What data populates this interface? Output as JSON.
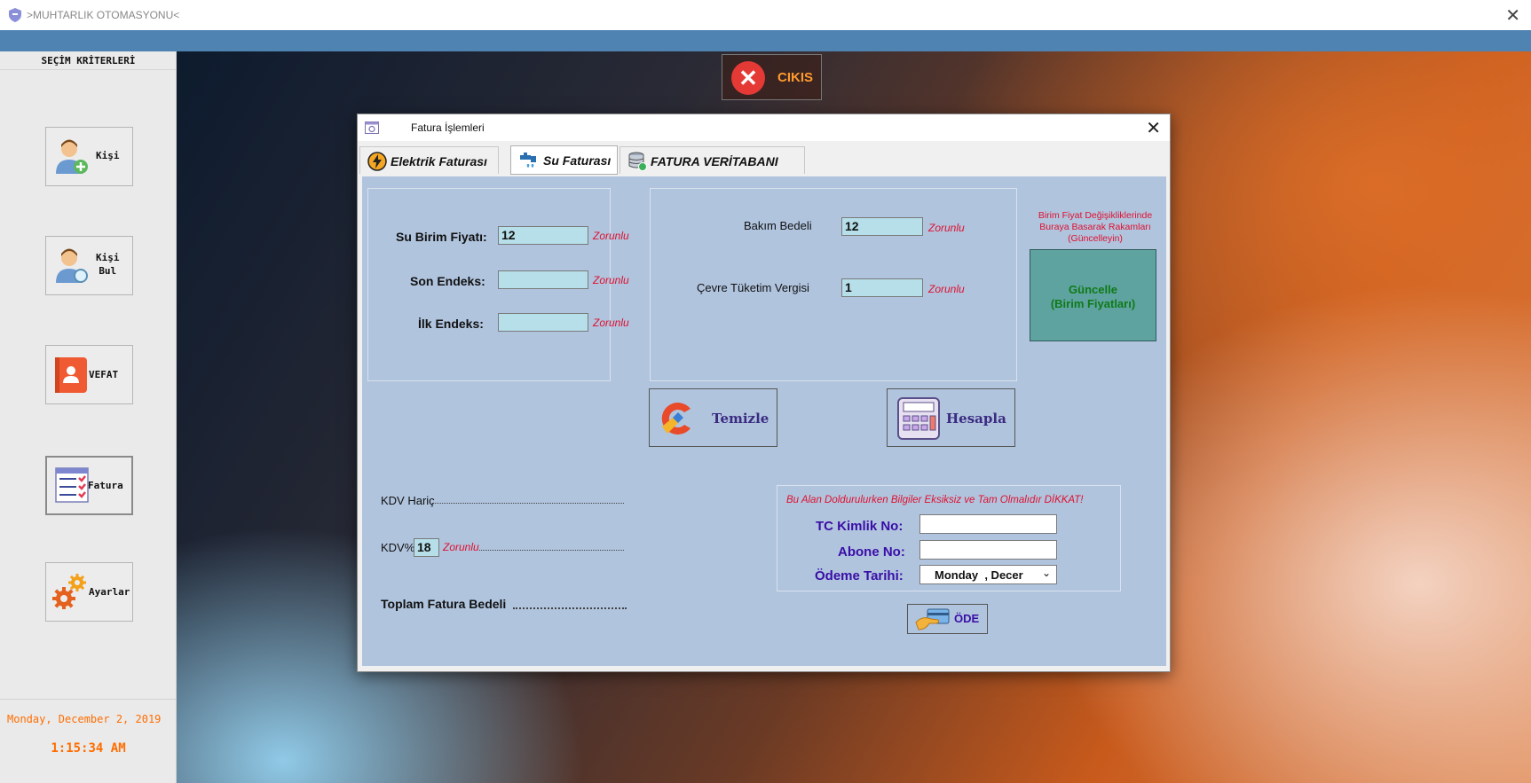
{
  "window": {
    "title": " >MUHTARLIK OTOMASYONU<"
  },
  "sidebar": {
    "criteria_title": "SEÇİM KRİTERLERİ",
    "buttons": [
      {
        "line1": "Kişi",
        "line2": ""
      },
      {
        "line1": "Kişi",
        "line2": "Bul"
      },
      {
        "line1": "VEFAT",
        "line2": ""
      },
      {
        "line1": "Fatura",
        "line2": ""
      },
      {
        "line1": "Ayarlar",
        "line2": ""
      }
    ],
    "date": "Monday, December 2, 2019",
    "time": "1:15:34 AM"
  },
  "exit_button": {
    "label": "CIKIS"
  },
  "dialog": {
    "title": "Fatura İşlemleri",
    "tabs": [
      {
        "label": "Elektrik Faturası"
      },
      {
        "label": "Su Faturası"
      },
      {
        "label": "FATURA VERİTABANI"
      }
    ],
    "water": {
      "unit_price_label": "Su Birim Fiyatı:",
      "unit_price_value": "12",
      "last_index_label": "Son Endeks:",
      "last_index_value": "",
      "first_index_label": "İlk Endeks:",
      "first_index_value": "",
      "required": "Zorunlu"
    },
    "fees": {
      "maintenance_label": "Bakım Bedeli",
      "maintenance_value": "12",
      "env_tax_label": "Çevre Tüketim Vergisi",
      "env_tax_value": "1"
    },
    "update_note": "Birim Fiyat Değişikliklerinde Buraya Basarak Rakamları (Güncelleyin)",
    "update_button": {
      "line1": "Güncelle",
      "line2": "(Birim Fiyatları)"
    },
    "clear_button": "Temizle",
    "calc_button": "Hesapla",
    "kdv_haric_label": "KDV Hariç",
    "kdv_label": "KDV%",
    "kdv_value": "18",
    "total_label": "Toplam Fatura Bedeli",
    "payment": {
      "warning": "Bu Alan Doldurulurken Bilgiler Eksiksiz ve Tam Olmalıdır DİKKAT!",
      "tc_label": "TC Kimlik No:",
      "tc_value": "",
      "subscriber_label": "Abone No:",
      "subscriber_value": "",
      "date_label": "Ödeme Tarihi:",
      "date_value": "Monday  , Decer"
    },
    "pay_button": "ÖDE"
  }
}
